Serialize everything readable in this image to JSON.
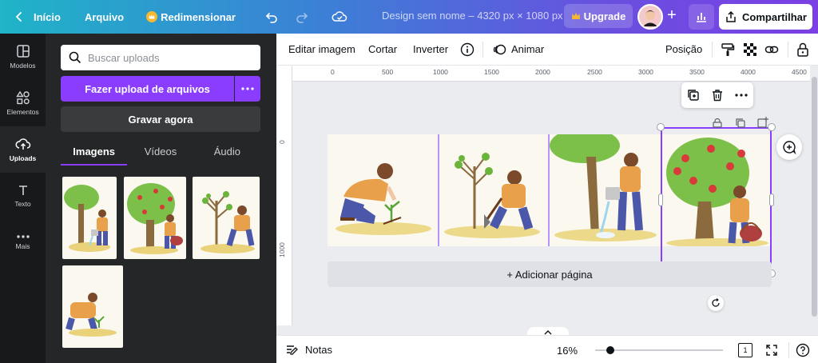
{
  "topbar": {
    "home_label": "Início",
    "file_label": "Arquivo",
    "resize_label": "Redimensionar",
    "design_title": "Design sem nome – 4320 px × 1080 px",
    "upgrade_label": "Upgrade",
    "share_label": "Compartilhar"
  },
  "rail": {
    "items": [
      {
        "label": "Modelos"
      },
      {
        "label": "Elementos"
      },
      {
        "label": "Uploads"
      },
      {
        "label": "Texto"
      },
      {
        "label": "Mais"
      }
    ]
  },
  "panel": {
    "search_placeholder": "Buscar uploads",
    "upload_label": "Fazer upload de arquivos",
    "record_label": "Gravar agora",
    "tabs": [
      {
        "label": "Imagens"
      },
      {
        "label": "Vídeos"
      },
      {
        "label": "Áudio"
      }
    ]
  },
  "toolbar": {
    "edit_image": "Editar imagem",
    "crop": "Cortar",
    "flip": "Inverter",
    "animate": "Animar",
    "position": "Posição"
  },
  "ruler": {
    "top_ticks": [
      "0",
      "500",
      "1000",
      "1500",
      "2000",
      "2500",
      "3000",
      "3500",
      "4000",
      "4500"
    ],
    "left_ticks": [
      "0",
      "1000"
    ]
  },
  "canvas": {
    "add_page_label": "+ Adicionar página"
  },
  "footer": {
    "notes_label": "Notas",
    "zoom_value": "16%",
    "page_number": "1"
  },
  "colors": {
    "accent": "#8b3dff",
    "dark_panel": "#252627",
    "rail_bg": "#18191b"
  }
}
